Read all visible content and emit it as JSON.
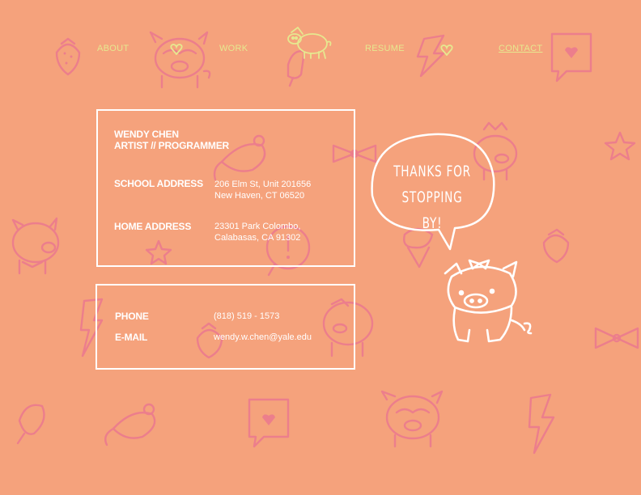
{
  "nav": {
    "about": "ABOUT",
    "work": "WORK",
    "resume": "RESUME",
    "contact": "CONTACT"
  },
  "profile": {
    "name": "WENDY CHEN",
    "title": "ARTIST // PROGRAMMER"
  },
  "school": {
    "label": "SCHOOL ADDRESS",
    "line1": "206 Elm St, Unit 201656",
    "line2": "New Haven, CT 06520"
  },
  "home": {
    "label": "HOME ADDRESS",
    "line1": "23301 Park Colombo,",
    "line2": "Calabasas, CA 91302"
  },
  "phone": {
    "label": "PHONE",
    "value": "(818) 519 - 1573"
  },
  "email": {
    "label": "E-MAIL",
    "value": "wendy.w.chen@yale.edu"
  },
  "bubble": {
    "line1": "THANKS FOR",
    "line2": "STOPPING BY!"
  },
  "colors": {
    "background": "#f5a27c",
    "doodle": "#ec7e8c",
    "nav_text": "#e6e88f",
    "card_border": "#ffffff"
  }
}
